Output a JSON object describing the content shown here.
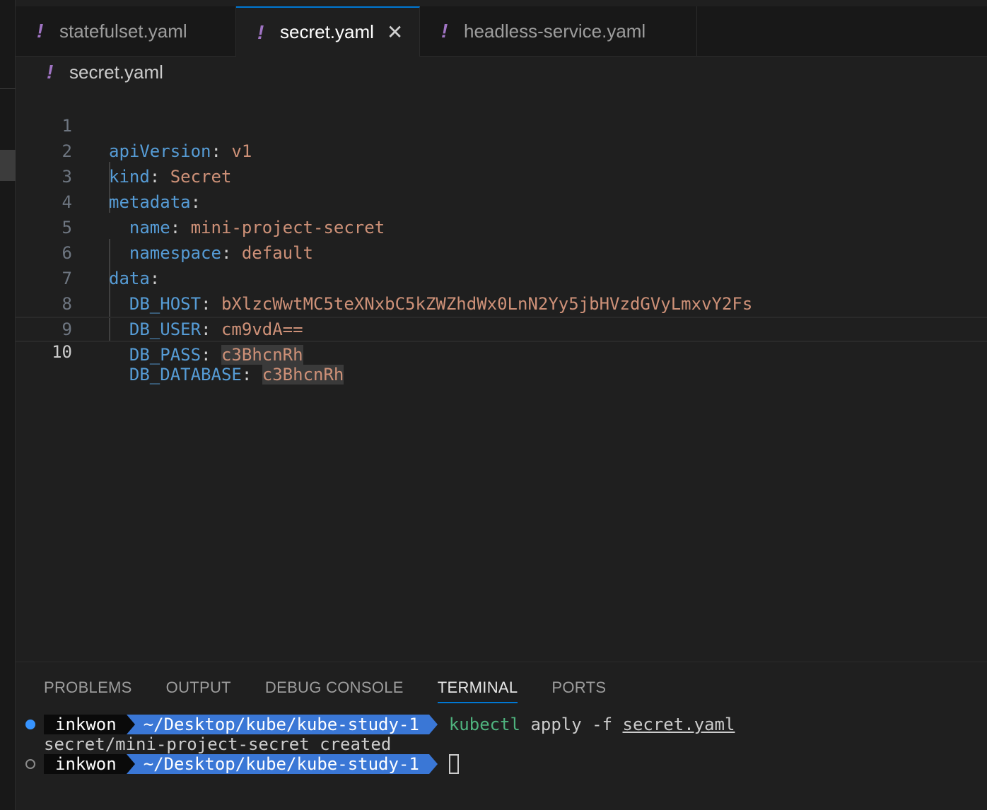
{
  "tabs": [
    {
      "icon": "!",
      "label": "statefulset.yaml",
      "active": false
    },
    {
      "icon": "!",
      "label": "secret.yaml",
      "active": true,
      "close": "✕"
    },
    {
      "icon": "!",
      "label": "headless-service.yaml",
      "active": false
    }
  ],
  "breadcrumb": {
    "icon": "!",
    "file": "secret.yaml"
  },
  "editor": {
    "current_line": 10,
    "lines": [
      {
        "n": "1",
        "key": "apiVersion",
        "sep": ":",
        "value": "v1"
      },
      {
        "n": "2",
        "key": "kind",
        "sep": ":",
        "value": "Secret"
      },
      {
        "n": "3",
        "key": "metadata",
        "sep": ":",
        "value": ""
      },
      {
        "n": "4",
        "indent": "  ",
        "key": "name",
        "sep": ":",
        "value": "mini-project-secret"
      },
      {
        "n": "5",
        "indent": "  ",
        "key": "namespace",
        "sep": ":",
        "value": "default"
      },
      {
        "n": "6",
        "key": "data",
        "sep": ":",
        "value": ""
      },
      {
        "n": "7",
        "indent": "  ",
        "key": "DB_HOST",
        "sep": ":",
        "value": "bXlzcWwtMC5teXNxbC5kZWZhdWx0LnN2Yy5jbHVzdGVyLmxvY2Fs"
      },
      {
        "n": "8",
        "indent": "  ",
        "key": "DB_USER",
        "sep": ":",
        "value": "cm9vdA=="
      },
      {
        "n": "9",
        "indent": "  ",
        "key": "DB_PASS",
        "sep": ":",
        "value": "c3BhcnRh"
      },
      {
        "n": "10",
        "indent": "  ",
        "key": "DB_DATABASE",
        "sep": ":",
        "value": "c3BhcnRh"
      }
    ]
  },
  "panel": {
    "tabs": [
      "PROBLEMS",
      "OUTPUT",
      "DEBUG CONSOLE",
      "TERMINAL",
      "PORTS"
    ],
    "active_tab": "TERMINAL"
  },
  "terminal": {
    "user": "inkwon",
    "path": "~/Desktop/kube/kube-study-1",
    "command": "kubectl",
    "args": "apply -f",
    "file_arg": "secret.yaml",
    "output": "secret/mini-project-secret created"
  },
  "colors": {
    "accent": "#0078d4",
    "yaml_key": "#569cd6",
    "yaml_value": "#ce9178",
    "yaml_icon": "#a074c4",
    "prompt_path_bg": "#3a77d6",
    "command": "#4fb37e"
  }
}
